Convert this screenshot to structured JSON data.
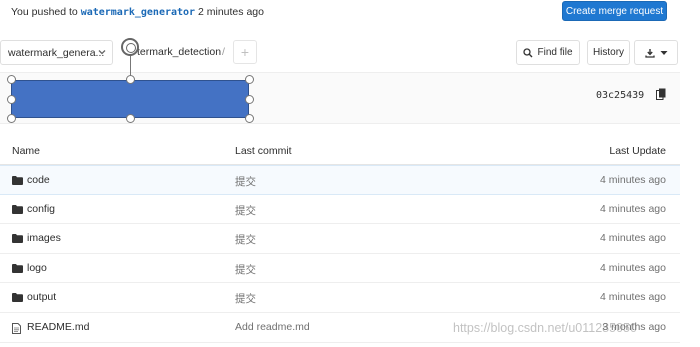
{
  "push_banner": {
    "prefix": "You pushed to",
    "branch": "watermark_generator",
    "suffix": "2 minutes ago",
    "merge_button": "Create merge request"
  },
  "toolbar": {
    "branch": "watermark_genera...",
    "path": "termark_detection",
    "path_separator": "/",
    "add_label": "+",
    "find_file": "Find file",
    "history": "History"
  },
  "commit": {
    "sha": "03c25439"
  },
  "table": {
    "headers": {
      "name": "Name",
      "last_commit": "Last commit",
      "last_update": "Last Update"
    },
    "rows": [
      {
        "icon": "folder-icon",
        "name": "code",
        "commit": "提交",
        "updated": "4 minutes ago"
      },
      {
        "icon": "folder-icon",
        "name": "config",
        "commit": "提交",
        "updated": "4 minutes ago"
      },
      {
        "icon": "folder-icon",
        "name": "images",
        "commit": "提交",
        "updated": "4 minutes ago"
      },
      {
        "icon": "folder-icon",
        "name": "logo",
        "commit": "提交",
        "updated": "4 minutes ago"
      },
      {
        "icon": "folder-icon",
        "name": "output",
        "commit": "提交",
        "updated": "4 minutes ago"
      },
      {
        "icon": "file-icon",
        "name": "README.md",
        "commit": "Add readme.md",
        "updated": "3 months ago"
      }
    ]
  },
  "watermark": "https://blog.csdn.net/u011285050",
  "colors": {
    "accent": "#1f78d1",
    "redact": "#4472c4"
  }
}
